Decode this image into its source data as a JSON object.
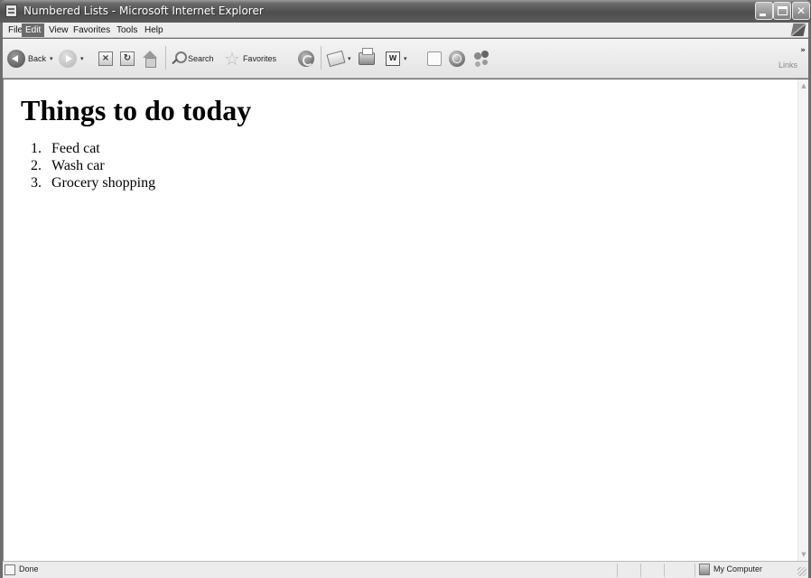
{
  "window": {
    "title": "Numbered Lists - Microsoft Internet Explorer"
  },
  "menubar": {
    "items": [
      "File",
      "Edit",
      "View",
      "Favorites",
      "Tools",
      "Help"
    ],
    "active": "Edit"
  },
  "toolbar": {
    "back_label": "Back",
    "search_label": "Search",
    "favorites_label": "Favorites",
    "links_label": "Links",
    "links_chevron": "»",
    "dropdown_arrow": "▾",
    "icons": [
      "back-icon",
      "forward-icon",
      "stop-icon",
      "refresh-icon",
      "home-icon",
      "search-icon",
      "favorites-star-icon",
      "media-icon",
      "mail-icon",
      "print-icon",
      "word-icon",
      "blank-page-icon",
      "globe-icon",
      "messenger-icon"
    ]
  },
  "page": {
    "heading": "Things to do today",
    "list": [
      {
        "num": "1.",
        "text": "Feed cat"
      },
      {
        "num": "2.",
        "text": "Wash car"
      },
      {
        "num": "3.",
        "text": "Grocery shopping"
      }
    ]
  },
  "statusbar": {
    "status_text": "Done",
    "zone_text": "My Computer"
  },
  "colors": {
    "titlebar": "#4e4e4e",
    "menu_active_bg": "#6b6b6b",
    "page_bg": "#ffffff",
    "chrome_bg": "#ececec"
  }
}
